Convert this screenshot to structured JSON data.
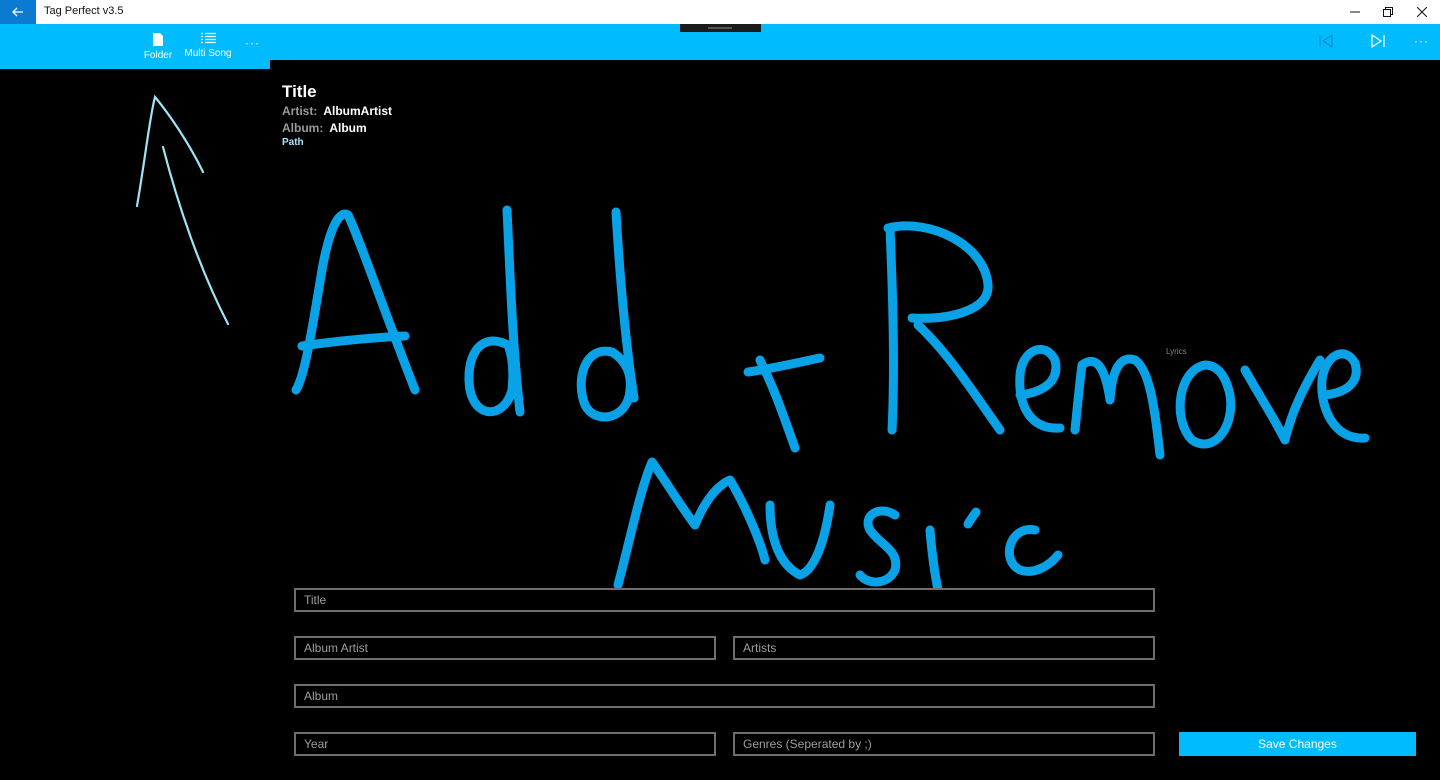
{
  "window": {
    "title": "Tag Perfect v3.5",
    "back_icon": "back-arrow-icon",
    "controls": [
      "minimize-icon",
      "restore-icon",
      "close-icon"
    ]
  },
  "commandbar": {
    "folder_label": "Folder",
    "multi_song_label": "Multi Song",
    "more": "···",
    "right_more": "···"
  },
  "song": {
    "title": "Title",
    "artist_key": "Artist:",
    "artist_value": "AlbumArtist",
    "album_key": "Album:",
    "album_value": "Album",
    "path": "Path"
  },
  "lyrics_label": "Lyrics",
  "form": {
    "title_placeholder": "Title",
    "album_artist_placeholder": "Album Artist",
    "artists_placeholder": "Artists",
    "album_placeholder": "Album",
    "year_placeholder": "Year",
    "genres_placeholder": "Genres (Seperated by ;)",
    "save_label": "Save Changes"
  },
  "ink_annotation": {
    "line1": "Add + Remove",
    "line2": "Music"
  },
  "colors": {
    "accent": "#00bcff",
    "back_button": "#0a7bd1",
    "ink": "#0aa2e6",
    "arrow_ink": "#9fe3f5"
  }
}
